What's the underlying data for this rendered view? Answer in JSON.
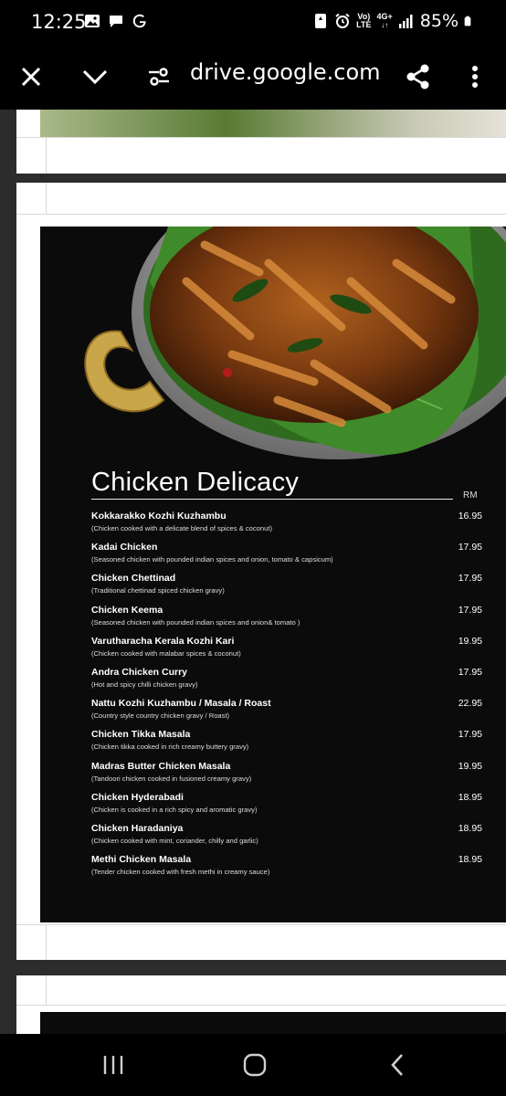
{
  "status_bar": {
    "time": "12:25",
    "battery": "85%",
    "network_line1": "Vo)",
    "network_line2": "LTE",
    "network_gen": "4G+"
  },
  "browser": {
    "url": "drive.google.com",
    "close_icon": "close-icon",
    "collapse_icon": "chevron-down-icon",
    "settings_icon": "site-settings-icon",
    "share_icon": "share-icon",
    "more_icon": "more-vert-icon"
  },
  "menu": {
    "title": "Chicken Delicacy",
    "currency": "RM",
    "items": [
      {
        "name": "Kokkarakko Kozhi Kuzhambu",
        "desc": "(Chicken cooked with a delicate blend of spices & coconut)",
        "price": "16.95"
      },
      {
        "name": "Kadai Chicken",
        "desc": "(Seasoned chicken with pounded indian spices and onion, tomato & capsicum)",
        "price": "17.95"
      },
      {
        "name": "Chicken Chettinad",
        "desc": "(Traditional chettinad spiced chicken gravy)",
        "price": "17.95"
      },
      {
        "name": "Chicken Keema",
        "desc": "(Seasoned chicken with pounded indian spices and onion& tomato )",
        "price": "17.95"
      },
      {
        "name": "Varutharacha Kerala Kozhi Kari",
        "desc": "(Chicken cooked with malabar spices & coconut)",
        "price": "19.95"
      },
      {
        "name": "Andra Chicken Curry",
        "desc": "(Hot and spicy chilli chicken gravy)",
        "price": "17.95"
      },
      {
        "name": "Nattu Kozhi Kuzhambu / Masala / Roast",
        "desc": "(Country style country chicken gravy / Roast)",
        "price": "22.95"
      },
      {
        "name": "Chicken Tikka Masala",
        "desc": "(Chicken tikka cooked in rich creamy buttery gravy)",
        "price": "17.95"
      },
      {
        "name": "Madras Butter Chicken Masala",
        "desc": "(Tandoori chicken cooked in fusioned creamy gravy)",
        "price": "19.95"
      },
      {
        "name": "Chicken Hyderabadi",
        "desc": "(Chicken is cooked in a rich spicy and aromatic gravy)",
        "price": "18.95"
      },
      {
        "name": "Chicken Haradaniya",
        "desc": "(Chicken cooked with mint, coriander, chilly and garlic)",
        "price": "18.95"
      },
      {
        "name": "Methi Chicken Masala",
        "desc": "(Tender chicken cooked with fresh methi in creamy sauce)",
        "price": "18.95"
      }
    ]
  },
  "nav": {
    "recents_icon": "recent-apps-icon",
    "home_icon": "home-icon",
    "back_icon": "back-icon"
  }
}
